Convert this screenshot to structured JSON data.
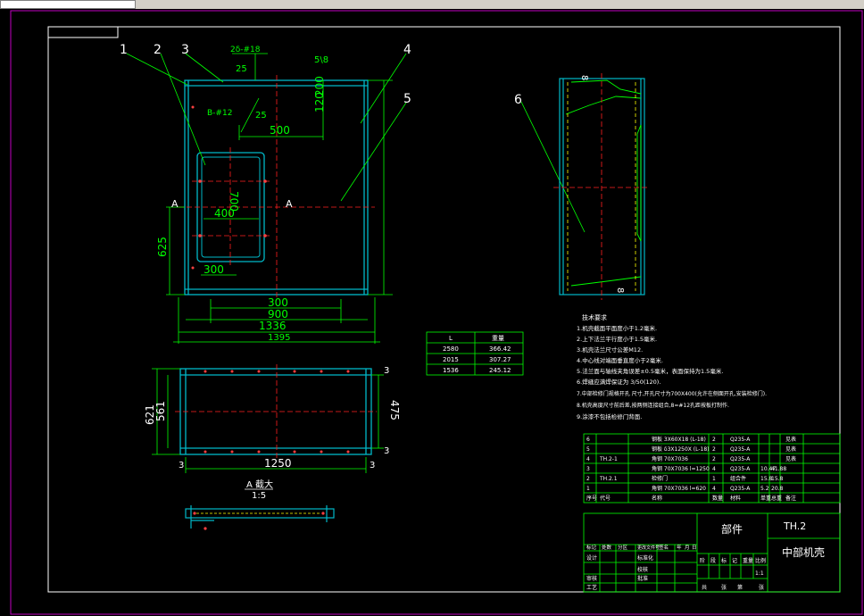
{
  "balloons": [
    "1",
    "2",
    "3",
    "4",
    "5",
    "6"
  ],
  "dims": {
    "weld_a": "2δ-#18",
    "weld_a_sub": "25",
    "weld_b": "B-#12",
    "weld_b_sub": "25",
    "top_note": "5\\8",
    "d120": "120",
    "d200": "200",
    "d500": "500",
    "d700": "700",
    "d400": "400",
    "d625": "625",
    "d300a": "300",
    "d300b": "300",
    "d900": "900",
    "d1336": "1336",
    "d1395": "1395",
    "d621": "621",
    "d561": "561",
    "d475": "475",
    "d1250": "1250",
    "d3a": "3",
    "d3b": "3",
    "d3c": "3",
    "d3d": "3",
    "side8a": "8",
    "side8b": "8",
    "sec_a_left": "A",
    "sec_a_right": "A"
  },
  "section_label": "A 截大",
  "section_scale": "1:5",
  "mini_table": {
    "headers": [
      "L",
      "重量"
    ],
    "rows": [
      [
        "2580",
        "366.42"
      ],
      [
        "2015",
        "307.27"
      ],
      [
        "1536",
        "245.12"
      ]
    ]
  },
  "notes": {
    "title": "技术要求",
    "lines": [
      "1.机壳截面平面度小于1.2毫米.",
      "2.上下法兰平行度小于1.5毫米.",
      "3.机壳法兰尺寸公差M12.",
      "4.中心线对端面垂直度小于2毫米.",
      "5.法兰面与轴线夹角误差±0.5毫米，表面保持为1.5毫米.",
      "6.焊缝应满焊保证为 3/50(120).",
      "7.中部检修门规格开孔 尺寸,开孔尺寸为700X400(允许在侧面开孔,安装检修门).",
      "8.机壳高度尺寸前后差,按两侧连接组合,8=#12孔距按板打制作.",
      "9.涂漆不包括检修门背面."
    ]
  },
  "bom": {
    "rows": [
      {
        "no": "6",
        "code": "",
        "name": "钢板 3X60X18 (L-18)",
        "qty": "2",
        "material": "Q235-A",
        "weight": "",
        "total": "",
        "remark": "见表"
      },
      {
        "no": "5",
        "code": "",
        "name": "钢板 δ3X1250X (L-18)",
        "qty": "2",
        "material": "Q235-A",
        "weight": "",
        "total": "",
        "remark": "见表"
      },
      {
        "no": "4",
        "code": "TH.2-1",
        "name": "角钢 70X7036",
        "qty": "2",
        "material": "Q235-A",
        "weight": "",
        "total": "",
        "remark": "见表"
      },
      {
        "no": "3",
        "code": "",
        "name": "角钢 70X7036 l=1250",
        "qty": "4",
        "material": "Q235-A",
        "weight": "10.47",
        "total": "41.88",
        "remark": ""
      },
      {
        "no": "2",
        "code": "TH.2.1",
        "name": "检修门",
        "qty": "1",
        "material": "组合件",
        "weight": "15.8",
        "total": "15.8",
        "remark": ""
      },
      {
        "no": "1",
        "code": "",
        "name": "角钢 70X7036 l=620",
        "qty": "4",
        "material": "Q235-A",
        "weight": "5.2",
        "total": "20.8",
        "remark": ""
      }
    ],
    "headers": {
      "no": "序号",
      "code": "代号",
      "name": "名称",
      "qty": "数量",
      "material": "材料",
      "weight": "单重",
      "total": "总重",
      "remark": "备注"
    }
  },
  "title_block": {
    "part_label": "部件",
    "drawing_no": "TH.2",
    "part_name": "中部机壳",
    "rev_row": [
      "标记",
      "处数",
      "分区",
      "更改文件号",
      "签名",
      "年",
      "月",
      "日"
    ],
    "design": "设计",
    "standard": "标准化",
    "proof": "校核",
    "review": "审核",
    "process": "工艺",
    "approve": "批准",
    "stage_labels": [
      "阶",
      "段",
      "标",
      "记"
    ],
    "weight_label": "重量",
    "scale_label": "比例",
    "scale": "1:1",
    "sheets": "共",
    "sheet_of": "张",
    "page": "第",
    "page_of": "张"
  },
  "colors": {
    "paper": "#000000",
    "border": "#ffffff",
    "outline": "#00b8c8",
    "dim": "#00ff00",
    "center": "#ff2020",
    "hidden": "#ffff00",
    "text": "#ffffff",
    "frame_accent": "#ff00ff"
  }
}
